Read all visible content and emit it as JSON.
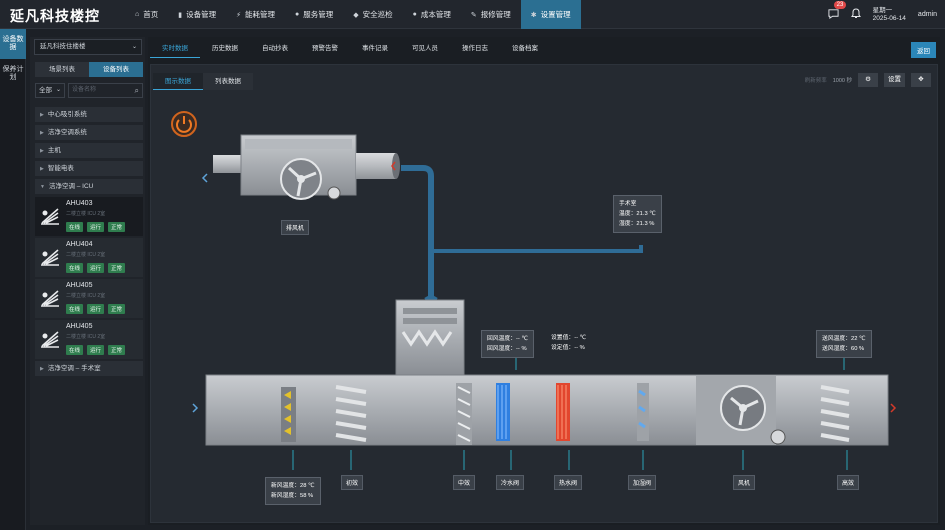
{
  "brand": {
    "title": "延凡科技楼控"
  },
  "nav": [
    {
      "label": "首页",
      "icon": "home-icon",
      "glyph": "⌂"
    },
    {
      "label": "设备管理",
      "icon": "device-icon",
      "glyph": "▮"
    },
    {
      "label": "能耗管理",
      "icon": "energy-icon",
      "glyph": "⚡"
    },
    {
      "label": "服务管理",
      "icon": "person-icon",
      "glyph": "●"
    },
    {
      "label": "安全巡检",
      "icon": "shield-icon",
      "glyph": "◆"
    },
    {
      "label": "成本管理",
      "icon": "coin-icon",
      "glyph": "●"
    },
    {
      "label": "报修管理",
      "icon": "wrench-icon",
      "glyph": "✎"
    },
    {
      "label": "设置管理",
      "icon": "settings-icon",
      "glyph": "✱"
    }
  ],
  "header": {
    "notice_count": "23",
    "weekday": "星期一",
    "date": "2025-06-14",
    "user": "admin"
  },
  "rail": [
    {
      "label": "设备数据"
    },
    {
      "label": "保养计划"
    }
  ],
  "side": {
    "building": "延凡科技住楼楼",
    "tabs": [
      "场景列表",
      "设备列表"
    ],
    "filter_value": "全部",
    "search_placeholder": "设备名称",
    "groups_top": [
      "中心吸引系统",
      "洁净空调系统",
      "主机",
      "智能电表",
      "洁净空调 – ICU"
    ],
    "devices": [
      {
        "name": "AHU403",
        "sub": "二楼立楼 ICU 2室",
        "tags": [
          "在线",
          "运行",
          "正常"
        ]
      },
      {
        "name": "AHU404",
        "sub": "二楼立楼 ICU 2室",
        "tags": [
          "在线",
          "运行",
          "正常"
        ]
      },
      {
        "name": "AHU405",
        "sub": "二楼立楼 ICU 2室",
        "tags": [
          "在线",
          "运行",
          "正常"
        ]
      },
      {
        "name": "AHU405",
        "sub": "二楼立楼 ICU 2室",
        "tags": [
          "在线",
          "运行",
          "正常"
        ]
      }
    ],
    "group_bottom": "洁净空调 – 手术室"
  },
  "main": {
    "tabs": [
      "实时数据",
      "历史数据",
      "自动抄表",
      "预警告警",
      "事件记录",
      "可见人员",
      "操作日志",
      "设备档案"
    ],
    "back": "返回",
    "view_tabs": [
      "图示数据",
      "列表数据"
    ],
    "refresh_label": "刷新频率",
    "refresh_value": "1000 秒",
    "settings_label": "设置"
  },
  "diagram": {
    "exhaust_fan": "排风机",
    "room": {
      "title": "手术室",
      "temp": "温度：21.3 ℃",
      "hum": "湿度：21.3 %"
    },
    "return_air": {
      "temp": "回风温度：-- ℃",
      "hum": "回风湿度：-- %"
    },
    "setpoint": {
      "temp": "设置值：-- ℃",
      "hum": "设定值：-- %"
    },
    "supply_air": {
      "temp": "送风温度：22 ℃",
      "hum": "送风湿度：60 %"
    },
    "fresh_air": {
      "temp": "新风温度：28 ℃",
      "hum": "新风湿度：58 %"
    },
    "components": [
      "初效",
      "中效",
      "冷水阀",
      "热水阀",
      "加湿阀",
      "风机",
      "高效"
    ]
  },
  "colors": {
    "accent": "#2b6f92",
    "link": "#3aa5d7",
    "duct": "#2f6c96",
    "ok": "#2f7d4e",
    "alert": "#e04848"
  }
}
